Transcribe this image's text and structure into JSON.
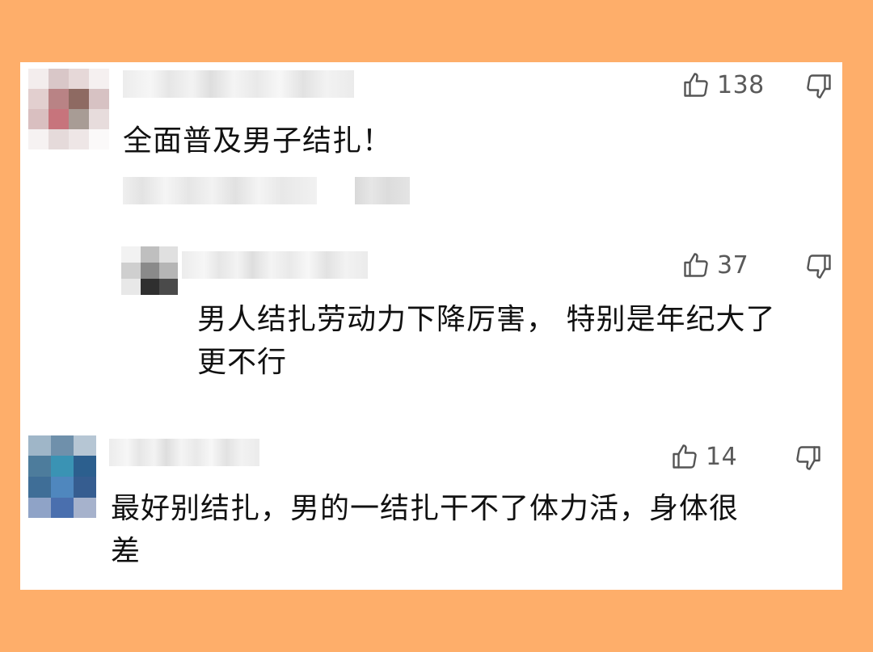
{
  "comments": [
    {
      "likes": "138",
      "text": "全面普及男子结扎！"
    },
    {
      "likes": "37",
      "text": "男人结扎劳动力下降厉害， 特别是年纪大了\n更不行"
    },
    {
      "likes": "14",
      "text": "最好别结扎，男的一结扎干不了体力活，身体很\n差"
    }
  ],
  "colors": {
    "background": "#FEAE6A",
    "card": "#FFFFFF",
    "text": "#111111",
    "icon": "#555555"
  },
  "icons": {
    "like": "thumbs-up-icon",
    "dislike": "thumbs-down-icon"
  }
}
